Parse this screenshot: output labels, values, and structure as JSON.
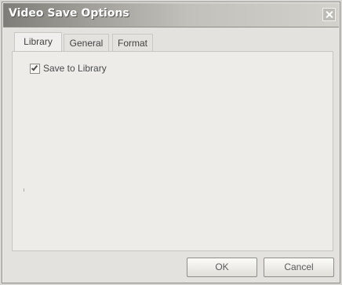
{
  "window": {
    "title": "Video Save Options"
  },
  "tabs": [
    {
      "label": "Library",
      "selected": true
    },
    {
      "label": "General",
      "selected": false
    },
    {
      "label": "Format",
      "selected": false
    }
  ],
  "library_tab": {
    "save_to_library": {
      "label": "Save to Library",
      "checked": true
    }
  },
  "buttons": {
    "ok_label": "OK",
    "cancel_label": "Cancel"
  },
  "icons": {
    "close": "close-icon",
    "checkmark": "checkmark-icon"
  }
}
